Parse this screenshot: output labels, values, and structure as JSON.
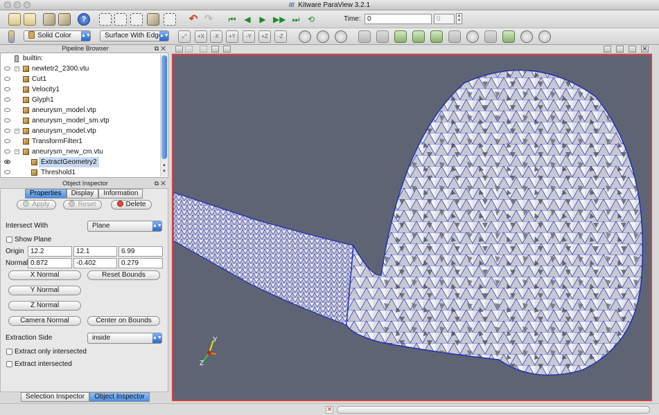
{
  "window": {
    "title": "Kitware ParaView 3.2.1"
  },
  "toolbar": {
    "time_label": "Time:",
    "time_value": "0",
    "timestep_value": "0",
    "color_by": "Solid Color",
    "representation": "Surface With Edges"
  },
  "pipeline_browser": {
    "title": "Pipeline Browser",
    "items": [
      {
        "label": "builtin:"
      },
      {
        "label": "newtetr2_2300.vtu"
      },
      {
        "label": "Cut1"
      },
      {
        "label": "Velocity1"
      },
      {
        "label": "Glyph1"
      },
      {
        "label": "aneurysm_model.vtp"
      },
      {
        "label": "aneurysm_model_sm.vtp"
      },
      {
        "label": "aneurysm_model.vtp"
      },
      {
        "label": "TransformFilter1"
      },
      {
        "label": "aneurysm_new_cm.vtu"
      },
      {
        "label": "ExtractGeometry2"
      },
      {
        "label": "Threshold1"
      }
    ]
  },
  "object_inspector": {
    "title": "Object Inspector",
    "tabs": [
      "Properties",
      "Display",
      "Information"
    ],
    "apply_label": "Apply",
    "reset_label": "Reset",
    "delete_label": "Delete",
    "intersect_with_label": "Intersect With",
    "intersect_with_value": "Plane",
    "show_plane_label": "Show Plane",
    "origin_label": "Origin",
    "origin": [
      "12.2",
      "12.1",
      "6.99"
    ],
    "normal_label": "Normal",
    "normal": [
      "0.872",
      "-0.402",
      "0.279"
    ],
    "x_normal": "X Normal",
    "reset_bounds": "Reset Bounds",
    "y_normal": "Y Normal",
    "z_normal": "Z Normal",
    "camera_normal": "Camera Normal",
    "center_on_bounds": "Center on Bounds",
    "extraction_side_label": "Extraction Side",
    "extraction_side_value": "inside",
    "extract_only_intersected": "Extract only intersected",
    "extract_intersected": "Extract intersected"
  },
  "bottom_tabs": [
    "Selection Inspector",
    "Object Inspector"
  ],
  "viewport": {
    "axis_x": "X",
    "axis_y": "Y",
    "axis_z": "Z",
    "background": "#5e6474",
    "mesh_edge_color": "#1c2bb0"
  }
}
